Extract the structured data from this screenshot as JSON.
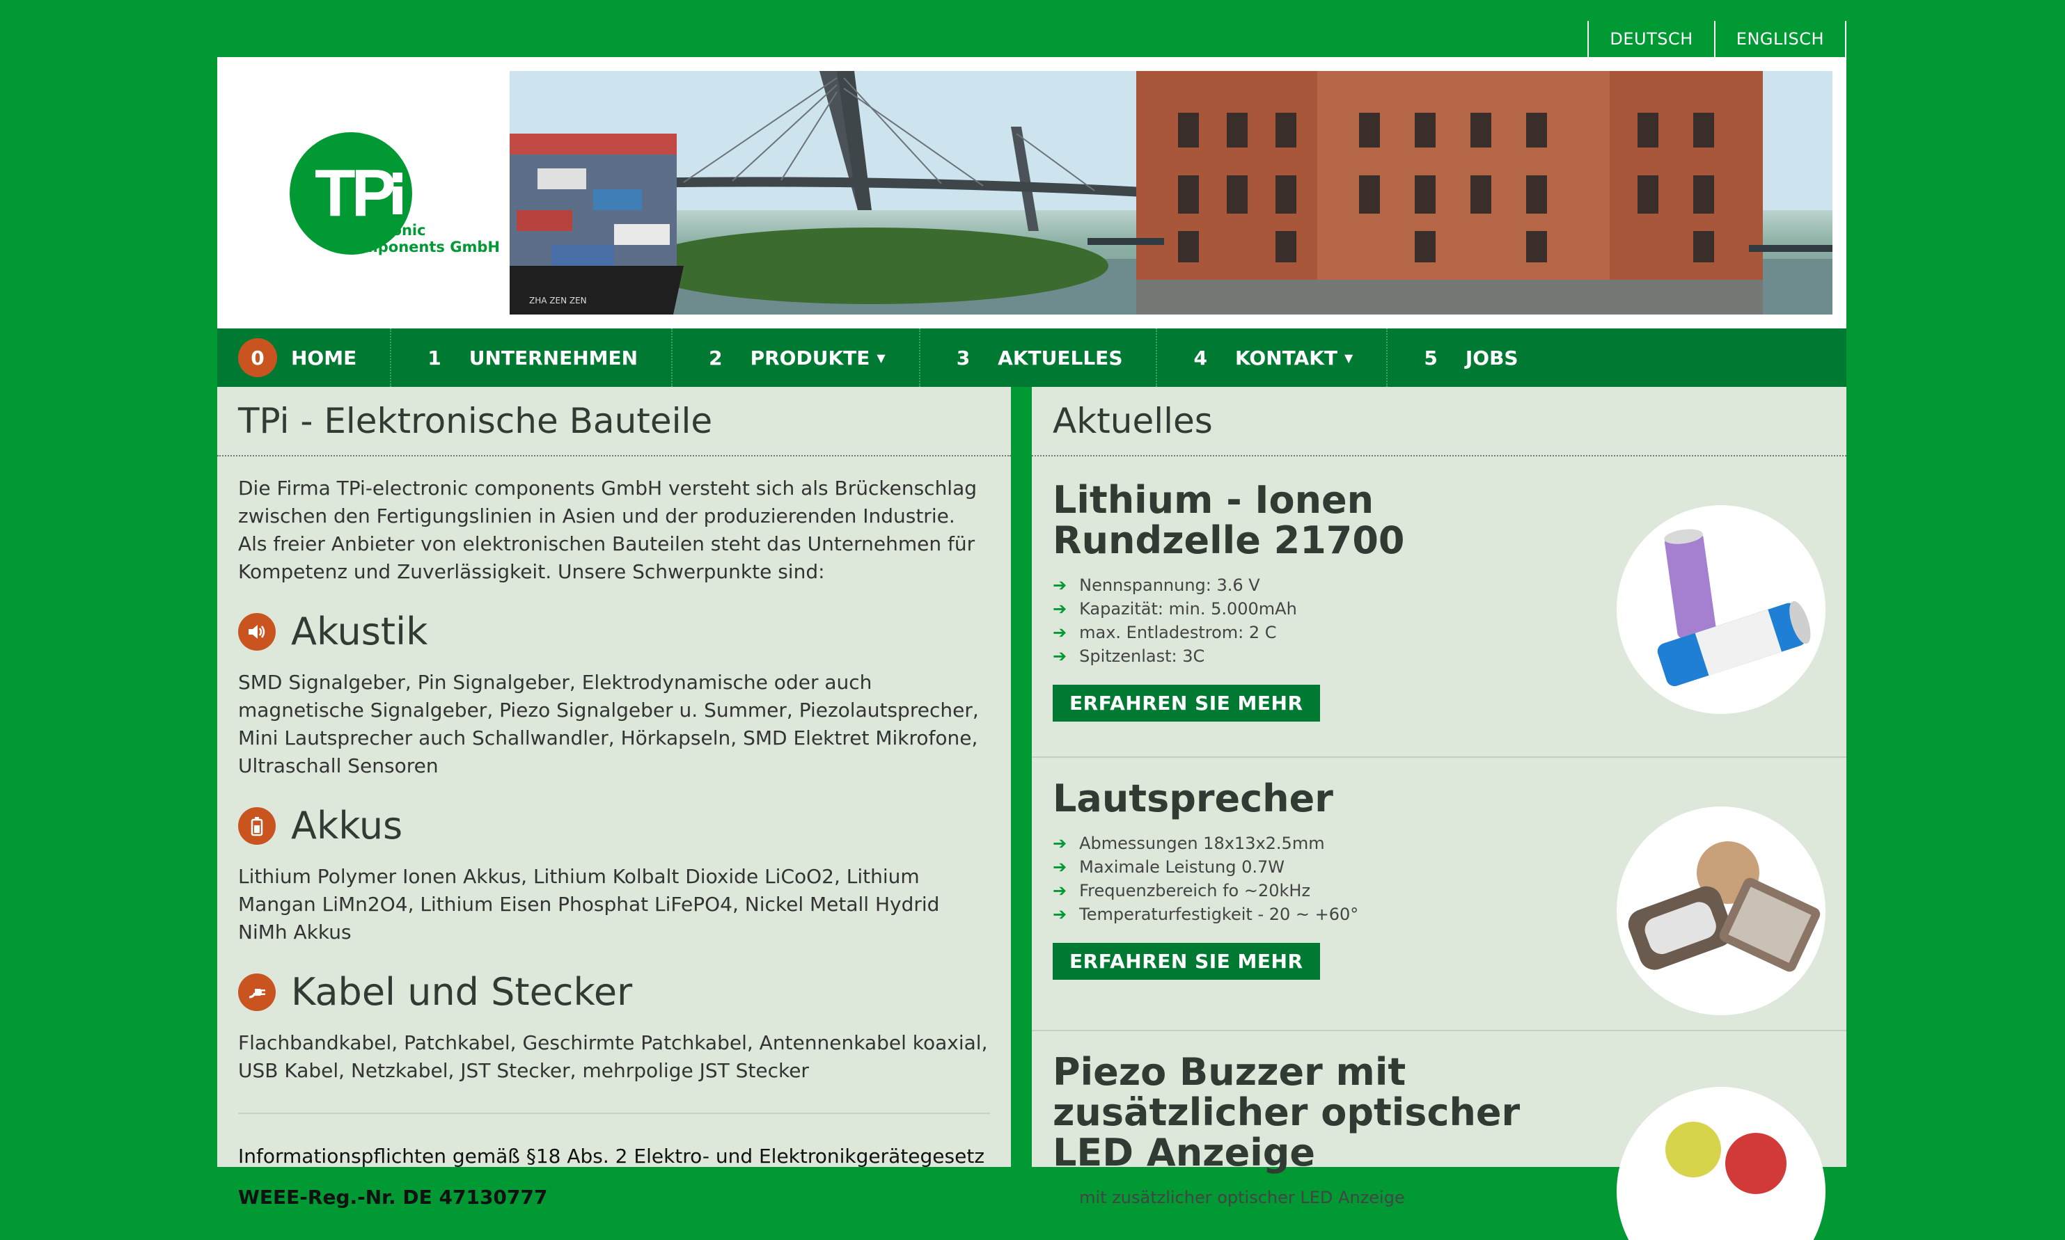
{
  "lang": {
    "de": "DEUTSCH",
    "en": "ENGLISCH"
  },
  "logo": {
    "mark": "TP",
    "line1": "electronic",
    "line2": "components GmbH"
  },
  "banner": {
    "ship_text": "ZHA ZEN ZEN"
  },
  "nav": [
    {
      "num": "0",
      "label": "HOME",
      "caret": false
    },
    {
      "num": "1",
      "label": "UNTERNEHMEN",
      "caret": false
    },
    {
      "num": "2",
      "label": "PRODUKTE",
      "caret": true
    },
    {
      "num": "3",
      "label": "AKTUELLES",
      "caret": false
    },
    {
      "num": "4",
      "label": "KONTAKT",
      "caret": true
    },
    {
      "num": "5",
      "label": "JOBS",
      "caret": false
    }
  ],
  "left": {
    "title": "TPi - Elektronische Bauteile",
    "intro": "Die Firma TPi-electronic components GmbH versteht sich als Brückenschlag zwischen den Fertigungslinien in Asien und der produzierenden Industrie. Als freier Anbieter von elektronischen Bauteilen steht das Unternehmen für Kompetenz und Zuverlässigkeit. Unsere Schwerpunkte sind:",
    "sections": [
      {
        "title": "Akustik",
        "text": "SMD Signalgeber, Pin Signalgeber, Elektrodynamische oder auch magnetische Signalgeber, Piezo Signalgeber u. Summer, Piezolautsprecher, Mini Lautsprecher auch Schallwandler, Hörkapseln, SMD Elektret Mikrofone, Ultraschall Sensoren"
      },
      {
        "title": "Akkus",
        "text": "Lithium Polymer Ionen Akkus, Lithium Kolbalt Dioxide LiCoO2, Lithium Mangan LiMn2O4, Lithium Eisen Phosphat LiFePO4, Nickel Metall Hydrid NiMh Akkus"
      },
      {
        "title": "Kabel und Stecker",
        "text": "Flachbandkabel, Patchkabel, Geschirmte Patchkabel, Antennenkabel koaxial, USB Kabel, Netzkabel, JST Stecker, mehrpolige JST Stecker"
      }
    ],
    "info": "Informationspflichten gemäß §18 Abs. 2 Elektro- und Elektronikgerätegesetz",
    "weee": "WEEE-Reg.-Nr. DE 47130777"
  },
  "right": {
    "title": "Aktuelles",
    "more_label": "ERFAHREN SIE MEHR",
    "news": [
      {
        "title": "Lithium - Ionen Rundzelle 21700",
        "items": [
          "Nennspannung: 3.6 V",
          "Kapazität: min. 5.000mAh",
          "max. Entladestrom: 2 C",
          "Spitzenlast: 3C"
        ]
      },
      {
        "title": "Lautsprecher",
        "items": [
          "Abmessungen 18x13x2.5mm",
          "Maximale Leistung 0.7W",
          "Frequenzbereich fo ~20kHz",
          "Temperaturfestigkeit - 20 ~ +60°"
        ]
      },
      {
        "title": "Piezo Buzzer mit zusätzlicher optischer LED Anzeige",
        "items": [
          "mit zusätzlicher optischer LED Anzeige"
        ]
      }
    ]
  },
  "colors": {
    "page_bg": "#009933",
    "nav_bg": "#007a33",
    "accent": "#c9541f",
    "panel_bg": "#dde7da"
  }
}
